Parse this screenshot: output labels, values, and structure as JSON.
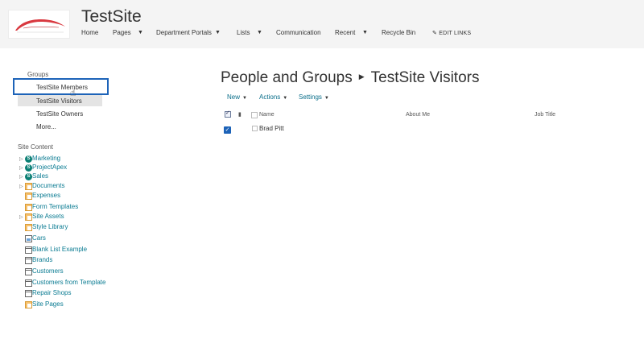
{
  "site": {
    "title": "TestSite"
  },
  "topnav": {
    "items": [
      {
        "label": "Home",
        "dropdown": false
      },
      {
        "label": "Pages",
        "dropdown": true
      },
      {
        "label": "Department Portals",
        "dropdown": true
      },
      {
        "label": "Lists",
        "dropdown": true
      },
      {
        "label": "Communication",
        "dropdown": false
      },
      {
        "label": "Recent",
        "dropdown": true
      },
      {
        "label": "Recycle Bin",
        "dropdown": false
      }
    ],
    "edit_links": "EDIT LINKS",
    "edit_icon": "pencil-icon"
  },
  "quicklaunch": {
    "groups_heading": "Groups",
    "groups": [
      {
        "label": "TestSite Members"
      },
      {
        "label": "TestSite Visitors",
        "selected": true
      },
      {
        "label": "TestSite Owners"
      },
      {
        "label": "More..."
      }
    ],
    "site_content_heading": "Site Content",
    "site_content": [
      {
        "label": "Marketing",
        "icon": "subsite-icon",
        "expandable": true
      },
      {
        "label": "ProjectApex",
        "icon": "subsite-icon",
        "expandable": true
      },
      {
        "label": "Sales",
        "icon": "subsite-icon",
        "expandable": true
      },
      {
        "label": "Documents",
        "icon": "library-icon",
        "expandable": true
      },
      {
        "label": "Expenses",
        "icon": "library-icon",
        "expandable": false
      },
      {
        "label": "Form Templates",
        "icon": "library-icon",
        "expandable": false
      },
      {
        "label": "Site Assets",
        "icon": "library-icon",
        "expandable": true
      },
      {
        "label": "Style Library",
        "icon": "library-icon",
        "expandable": false
      },
      {
        "label": "Cars",
        "icon": "picture-library-icon",
        "expandable": false
      },
      {
        "label": "Blank List Example",
        "icon": "list-icon",
        "expandable": false
      },
      {
        "label": "Brands",
        "icon": "list-icon",
        "expandable": false
      },
      {
        "label": "Customers",
        "icon": "list-icon",
        "expandable": false
      },
      {
        "label": "Customers from Template",
        "icon": "list-icon",
        "expandable": false
      },
      {
        "label": "Repair Shops",
        "icon": "list-icon",
        "expandable": false
      },
      {
        "label": "Site Pages",
        "icon": "library-icon",
        "expandable": false
      }
    ]
  },
  "main": {
    "breadcrumb_root": "People and Groups",
    "breadcrumb_current": "TestSite Visitors",
    "toolbar": [
      {
        "label": "New"
      },
      {
        "label": "Actions"
      },
      {
        "label": "Settings"
      }
    ],
    "columns": {
      "name": "Name",
      "about": "About Me",
      "job": "Job Title"
    },
    "rows": [
      {
        "name": "Brad Pitt",
        "checked": true
      }
    ]
  },
  "colors": {
    "accent": "#1d63b8",
    "link": "#0a7b92",
    "header_bg": "#f4f4f4"
  }
}
